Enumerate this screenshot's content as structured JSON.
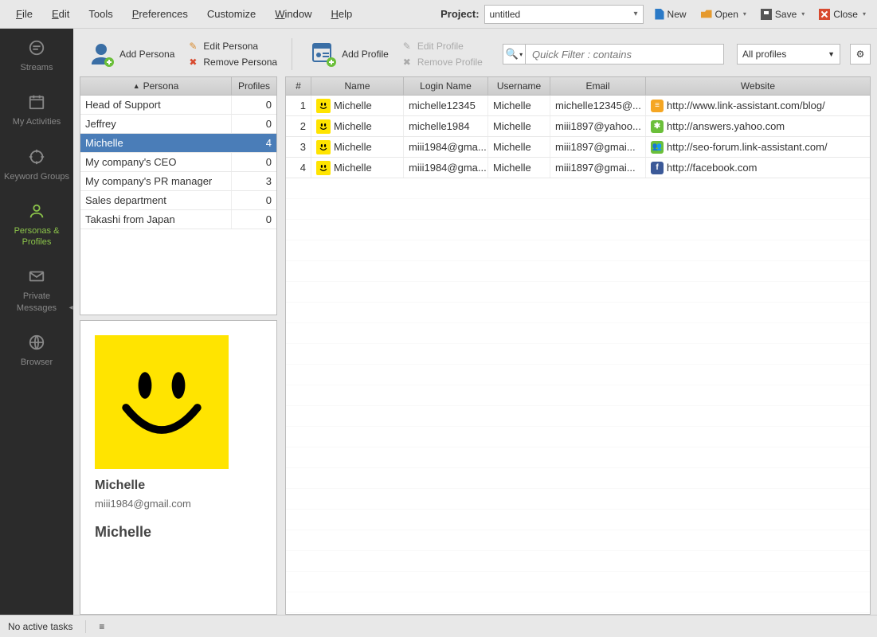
{
  "menu": {
    "file": "File",
    "edit": "Edit",
    "tools": "Tools",
    "preferences": "Preferences",
    "customize": "Customize",
    "window": "Window",
    "help": "Help"
  },
  "project": {
    "label": "Project:",
    "value": "untitled"
  },
  "topActions": {
    "new": "New",
    "open": "Open",
    "save": "Save",
    "close": "Close"
  },
  "sidebar": {
    "items": {
      "streams": "Streams",
      "activities": "My Activities",
      "keyword": "Keyword Groups",
      "personas": "Personas & Profiles",
      "messages": "Private Messages",
      "browser": "Browser"
    }
  },
  "toolbar": {
    "addPersona": "Add Persona",
    "editPersona": "Edit Persona",
    "removePersona": "Remove Persona",
    "addProfile": "Add Profile",
    "editProfile": "Edit Profile",
    "removeProfile": "Remove Profile",
    "quickFilterPlaceholder": "Quick Filter : contains",
    "profilesSelect": "All profiles"
  },
  "personaTable": {
    "headers": {
      "persona": "Persona",
      "profiles": "Profiles"
    },
    "rows": [
      {
        "name": "Head of Support",
        "count": "0"
      },
      {
        "name": "Jeffrey",
        "count": "0"
      },
      {
        "name": "Michelle",
        "count": "4",
        "selected": true
      },
      {
        "name": "My company's CEO",
        "count": "0"
      },
      {
        "name": "My company's PR manager",
        "count": "3"
      },
      {
        "name": "Sales department",
        "count": "0"
      },
      {
        "name": "Takashi from Japan",
        "count": "0"
      }
    ]
  },
  "detail": {
    "name": "Michelle",
    "email": "miii1984@gmail.com",
    "name2": "Michelle"
  },
  "profilesTable": {
    "headers": {
      "num": "#",
      "name": "Name",
      "login": "Login Name",
      "user": "Username",
      "email": "Email",
      "site": "Website"
    },
    "rows": [
      {
        "num": "1",
        "name": "Michelle",
        "login": "michelle12345",
        "user": "Michelle",
        "email": "michelle12345@...",
        "site": "http://www.link-assistant.com/blog/",
        "siteColor": "#f5a623",
        "siteGlyph": "≡"
      },
      {
        "num": "2",
        "name": "Michelle",
        "login": "michelle1984",
        "user": "Michelle",
        "email": "miii1897@yahoo...",
        "site": "http://answers.yahoo.com",
        "siteColor": "#6bbf3a",
        "siteGlyph": "✱"
      },
      {
        "num": "3",
        "name": "Michelle",
        "login": "miii1984@gma...",
        "user": "Michelle",
        "email": "miii1897@gmai...",
        "site": "http://seo-forum.link-assistant.com/",
        "siteColor": "#6bbf3a",
        "siteGlyph": "👥"
      },
      {
        "num": "4",
        "name": "Michelle",
        "login": "miii1984@gma...",
        "user": "Michelle",
        "email": "miii1897@gmai...",
        "site": "http://facebook.com",
        "siteColor": "#3b5998",
        "siteGlyph": "f"
      }
    ]
  },
  "status": {
    "tasks": "No active tasks"
  }
}
